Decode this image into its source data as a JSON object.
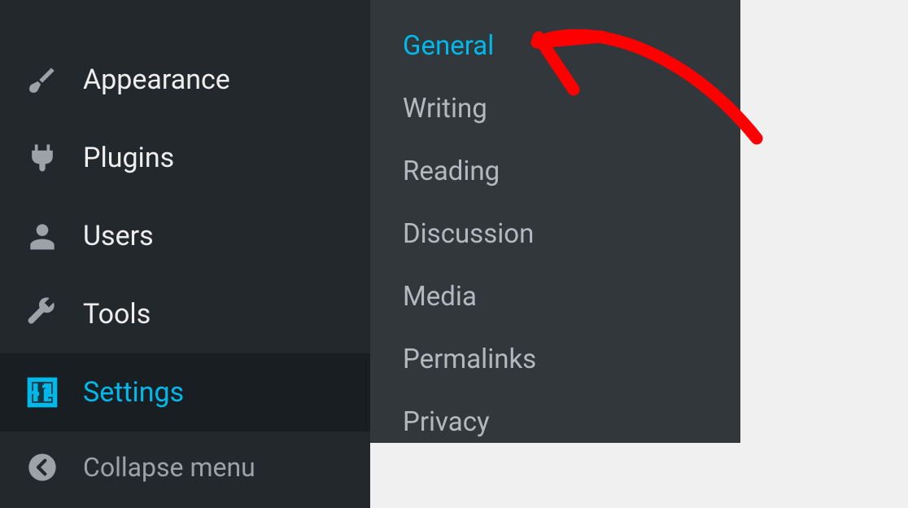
{
  "sidebar": {
    "items": [
      {
        "label": "Appearance",
        "icon": "brush"
      },
      {
        "label": "Plugins",
        "icon": "plug"
      },
      {
        "label": "Users",
        "icon": "user"
      },
      {
        "label": "Tools",
        "icon": "wrench"
      },
      {
        "label": "Settings",
        "icon": "sliders",
        "active": true
      },
      {
        "label": "Collapse menu",
        "icon": "collapse",
        "collapse": true
      }
    ]
  },
  "submenu": {
    "items": [
      {
        "label": "General",
        "active": true
      },
      {
        "label": "Writing"
      },
      {
        "label": "Reading"
      },
      {
        "label": "Discussion"
      },
      {
        "label": "Media"
      },
      {
        "label": "Permalinks"
      },
      {
        "label": "Privacy"
      }
    ]
  }
}
